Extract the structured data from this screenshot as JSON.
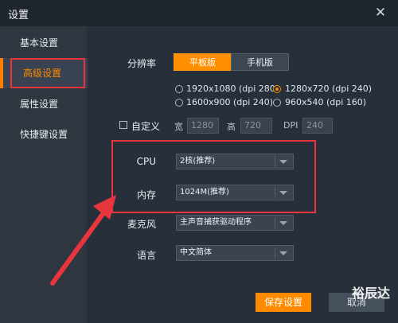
{
  "window": {
    "title": "设置",
    "close_glyph": "✕"
  },
  "sidebar": {
    "items": [
      {
        "label": "基本设置",
        "active": false
      },
      {
        "label": "高级设置",
        "active": true
      },
      {
        "label": "属性设置",
        "active": false
      },
      {
        "label": "快捷键设置",
        "active": false
      }
    ]
  },
  "resolution": {
    "label": "分辨率",
    "tabs": [
      "平板版",
      "手机版"
    ],
    "selected_tab": "平板版",
    "options": [
      "1920x1080 (dpi 280)",
      "1280x720 (dpi 240)",
      "1600x900 (dpi 240)",
      "960x540 (dpi 160)"
    ],
    "selected_option": "1280x720 (dpi 240)"
  },
  "custom": {
    "label": "自定义",
    "width_label": "宽",
    "width_value": "1280",
    "height_label": "高",
    "height_value": "720",
    "dpi_label": "DPI",
    "dpi_value": "240"
  },
  "cpu": {
    "label": "CPU",
    "value": "2核(推荐)"
  },
  "memory": {
    "label": "内存",
    "value": "1024M(推荐)"
  },
  "microphone": {
    "label": "麦克风",
    "value": "主声音捕获驱动程序"
  },
  "language": {
    "label": "语言",
    "value": "中文简体"
  },
  "buttons": {
    "save": "保存设置",
    "cancel": "取消"
  },
  "watermark": "裕辰达",
  "colors": {
    "accent": "#ff8a00",
    "highlight": "#e8353e",
    "background": "#27303a"
  }
}
